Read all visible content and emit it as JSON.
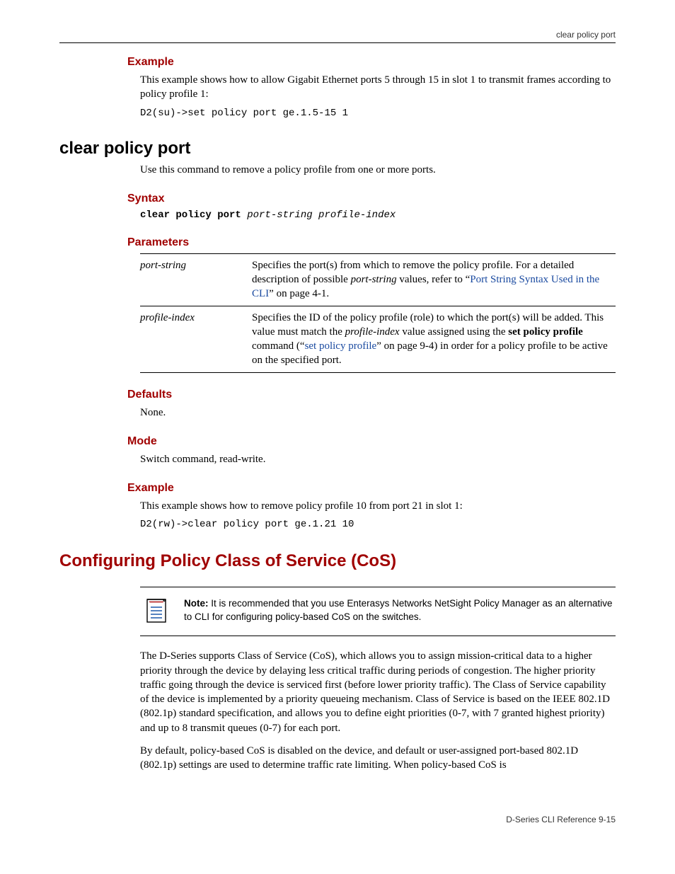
{
  "header": {
    "label": "clear policy port"
  },
  "ex1": {
    "heading": "Example",
    "text": "This example shows how to allow Gigabit Ethernet ports 5 through 15 in slot 1 to transmit frames according to policy profile 1:",
    "code": "D2(su)->set policy port ge.1.5-15 1"
  },
  "cmd": {
    "title": "clear policy port",
    "intro": "Use this command to remove a policy profile from one or more ports."
  },
  "syntax": {
    "heading": "Syntax",
    "bold": "clear policy port ",
    "ital": "port-string profile-index"
  },
  "params": {
    "heading": "Parameters",
    "rows": [
      {
        "term": "port-string",
        "pre": "Specifies the port(s) from which to remove the policy profile. For a detailed description of possible ",
        "ital": "port-string",
        "mid": " values, refer to “",
        "link": "Port String Syntax Used in the CLI",
        "post": "” on page 4-1."
      },
      {
        "term": "profile-index",
        "pre": "Specifies the ID of the policy profile (role) to which the port(s) will be added. This value must match the ",
        "ital": "profile-index",
        "mid": " value assigned using the ",
        "bold": "set policy profile",
        "mid2": " command (“",
        "link": "set policy profile",
        "post": "” on page 9-4) in order for a policy profile to be active on the specified port."
      }
    ]
  },
  "defaults": {
    "heading": "Defaults",
    "text": "None."
  },
  "mode": {
    "heading": "Mode",
    "text": "Switch command, read-write."
  },
  "ex2": {
    "heading": "Example",
    "text": "This example shows how to remove policy profile 10 from port 21 in slot 1:",
    "code": "D2(rw)->clear policy port ge.1.21 10"
  },
  "cos": {
    "title": "Configuring Policy Class of Service (CoS)",
    "note_label": "Note:",
    "note_text": " It is recommended that you use Enterasys Networks NetSight Policy Manager as an alternative to CLI for configuring policy-based CoS on the switches.",
    "p1": "The D-Series supports Class of Service (CoS), which allows you to assign mission-critical data to a higher priority through the device by delaying less critical traffic during periods of congestion. The higher priority traffic going through the device is serviced first (before lower priority traffic). The Class of Service capability of the device is implemented by a priority queueing mechanism. Class of Service is based on the IEEE 802.1D (802.1p) standard specification, and allows you to define eight priorities (0-7, with 7 granted highest priority) and up to 8 transmit queues (0-7) for each port.",
    "p2": "By default, policy-based CoS is disabled on the device, and default or user-assigned port-based 802.1D (802.1p) settings are used to determine traffic rate limiting. When policy-based CoS is"
  },
  "footer": {
    "text": "D-Series CLI Reference   9-15"
  }
}
